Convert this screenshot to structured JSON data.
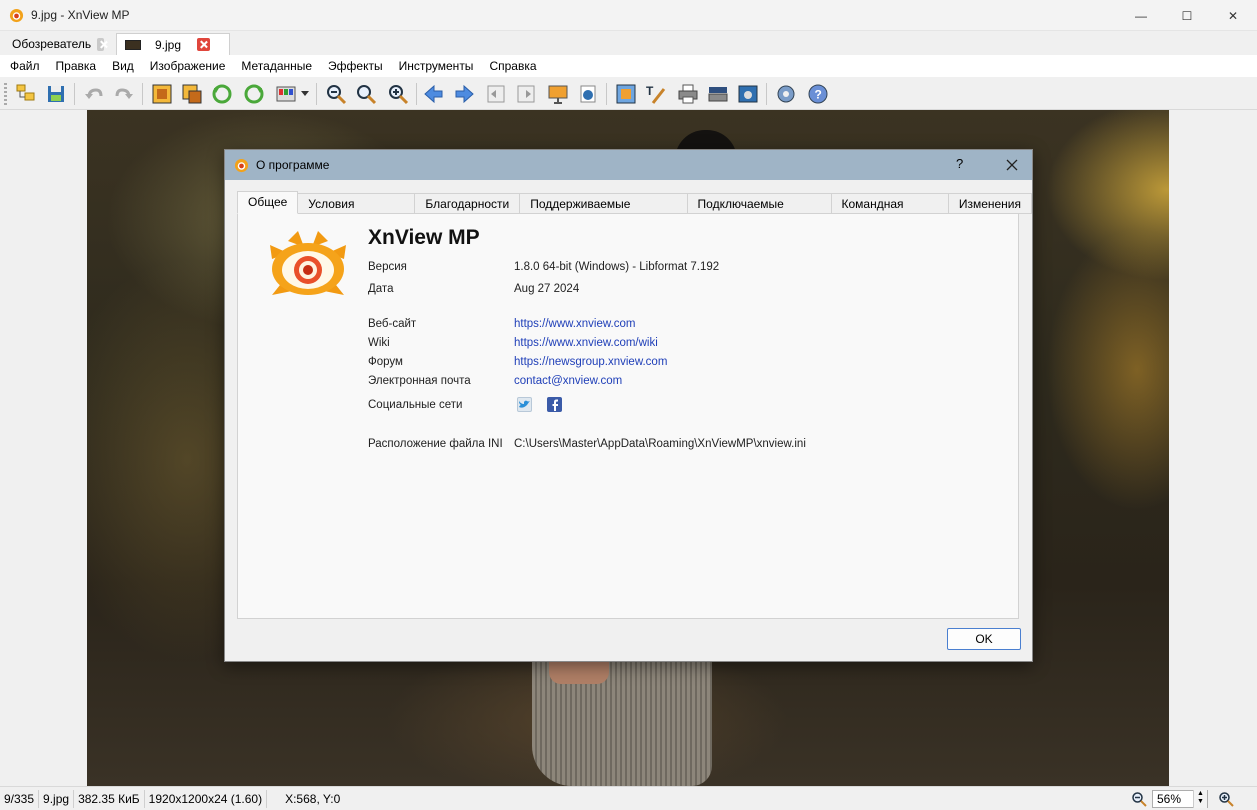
{
  "window": {
    "title": "9.jpg - XnView MP",
    "minimize_label": "—",
    "maximize_label": "☐",
    "close_label": "✕"
  },
  "doc_tabs": [
    {
      "label": "Обозреватель",
      "active": false
    },
    {
      "label": "9.jpg",
      "active": true
    }
  ],
  "menu": [
    "Файл",
    "Правка",
    "Вид",
    "Изображение",
    "Метаданные",
    "Эффекты",
    "Инструменты",
    "Справка"
  ],
  "toolbar": {
    "icons": [
      "browser-icon",
      "save-icon",
      "undo-icon",
      "redo-icon",
      "fit-image-icon",
      "crop-icon",
      "rotate-left-icon",
      "rotate-right-icon",
      "adjust-colors-icon",
      "dropdown-arrow-icon",
      "zoom-out-icon",
      "zoom-actual-icon",
      "zoom-in-icon",
      "previous-icon",
      "next-icon",
      "first-page-icon",
      "last-page-icon",
      "slideshow-icon",
      "info-icon",
      "fullscreen-icon",
      "edit-text-icon",
      "print-icon",
      "scan-icon",
      "capture-icon",
      "settings-icon",
      "help-icon"
    ]
  },
  "statusbar": {
    "index": "9/335",
    "filename": "9.jpg",
    "filesize": "382.35 КиБ",
    "dimensions": "1920x1200x24 (1.60)",
    "coords": "X:568, Y:0",
    "zoom": "56%"
  },
  "dialog": {
    "title": "О программе",
    "help_label": "?",
    "tabs": [
      "Общее",
      "Условия лицензии",
      "Благодарности",
      "Поддерживаемые форматы",
      "Подключаемые модули",
      "Командная строка",
      "Изменения"
    ],
    "selected_tab": "Общее",
    "product_name": "XnView MP",
    "rows": {
      "version_label": "Версия",
      "version_value": "1.8.0 64-bit (Windows) - Libformat 7.192",
      "date_label": "Дата",
      "date_value": "Aug 27 2024",
      "website_label": "Веб-сайт",
      "website_value": "https://www.xnview.com",
      "wiki_label": "Wiki",
      "wiki_value": "https://www.xnview.com/wiki",
      "forum_label": "Форум",
      "forum_value": "https://newsgroup.xnview.com",
      "email_label": "Электронная почта",
      "email_value": "contact@xnview.com",
      "social_label": "Социальные сети",
      "ini_label": "Расположение файла INI",
      "ini_value": "C:\\Users\\Master\\AppData\\Roaming\\XnViewMP\\xnview.ini"
    },
    "social_icons": [
      "twitter-icon",
      "facebook-icon"
    ],
    "ok_label": "OK"
  },
  "colors": {
    "dialog_titlebar": "#9fb4c6",
    "link": "#1f3fb8",
    "ok_border": "#4a7fd0"
  }
}
